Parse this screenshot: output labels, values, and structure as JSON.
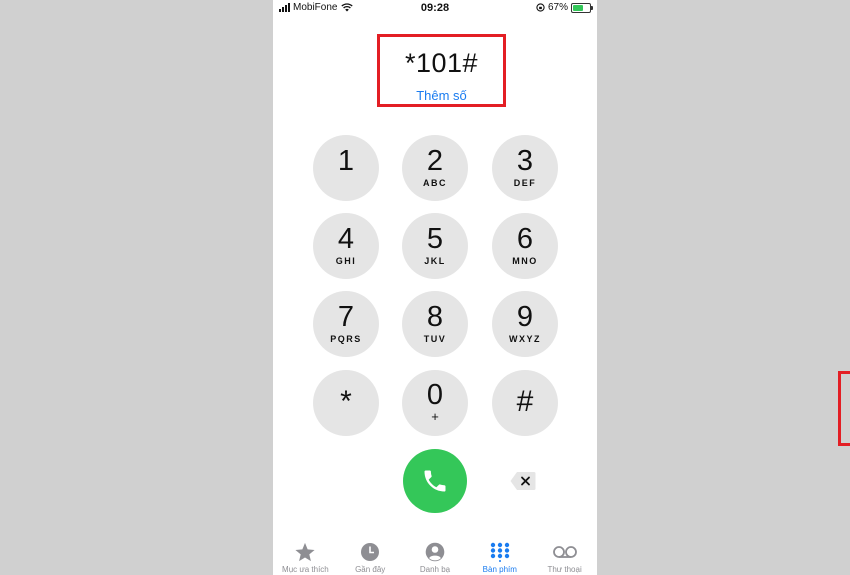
{
  "status_bar": {
    "carrier": "MobiFone",
    "time": "09:28",
    "battery_text": "67%",
    "battery_level": 0.67
  },
  "dialer": {
    "entered_number": "*101#",
    "add_number_label": "Thêm số"
  },
  "keypad": [
    {
      "digit": "1",
      "letters": ""
    },
    {
      "digit": "2",
      "letters": "ABC"
    },
    {
      "digit": "3",
      "letters": "DEF"
    },
    {
      "digit": "4",
      "letters": "GHI"
    },
    {
      "digit": "5",
      "letters": "JKL"
    },
    {
      "digit": "6",
      "letters": "MNO"
    },
    {
      "digit": "7",
      "letters": "PQRS"
    },
    {
      "digit": "8",
      "letters": "TUV"
    },
    {
      "digit": "9",
      "letters": "WXYZ"
    },
    {
      "digit": "*",
      "letters": ""
    },
    {
      "digit": "0",
      "letters": "+"
    },
    {
      "digit": "#",
      "letters": ""
    }
  ],
  "tabs": [
    {
      "label": "Mục ưa thích",
      "icon": "star-icon"
    },
    {
      "label": "Gần đây",
      "icon": "clock-icon"
    },
    {
      "label": "Danh bạ",
      "icon": "person-icon"
    },
    {
      "label": "Bàn phím",
      "icon": "keypad-icon",
      "active": true
    },
    {
      "label": "Thư thoại",
      "icon": "voicemail-icon"
    }
  ],
  "colors": {
    "accent": "#1a7cf0",
    "call_green": "#34c759",
    "highlight_red": "#e31e24",
    "key_gray": "#e5e5e5"
  }
}
